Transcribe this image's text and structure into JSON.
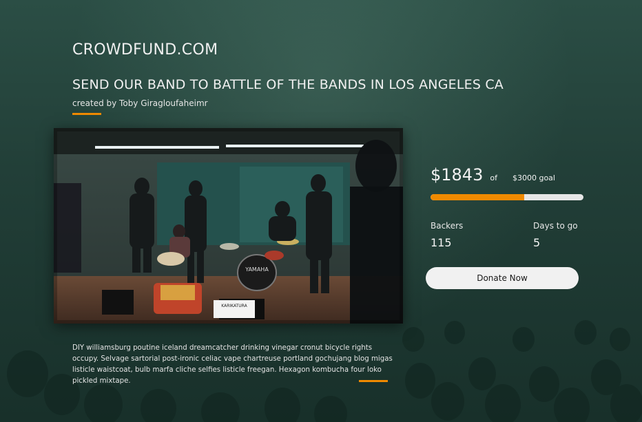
{
  "brand": {
    "name": "CROWDFUND.COM"
  },
  "campaign": {
    "title": "SEND  OUR BAND TO BATTLE OF THE BANDS IN LOS ANGELES CA",
    "creator": "created by Toby Giragloufaheimr",
    "description": "DIY williamsburg poutine iceland dreamcatcher drinking vinegar cronut bicycle rights occupy. Selvage sartorial post-ironic celiac vape chartreuse portland gochujang blog migas listicle waistcoat, bulb marfa cliche selfies listicle freegan. Hexagon kombucha four loko pickled mixtape.",
    "photo_sign_text": "KARIKATURA",
    "photo_drum_text": "YAMAHA"
  },
  "funding": {
    "raised": "$1843",
    "of_label": "of",
    "goal": "$3000 goal",
    "progress_fraction": 0.6143
  },
  "metrics": {
    "backers_label": "Backers",
    "backers_value": "115",
    "days_label": "Days to go",
    "days_value": "5"
  },
  "actions": {
    "donate_label": "Donate Now"
  },
  "colors": {
    "accent": "#f08a00",
    "background": "#223f38",
    "button": "#f1f1f1"
  }
}
